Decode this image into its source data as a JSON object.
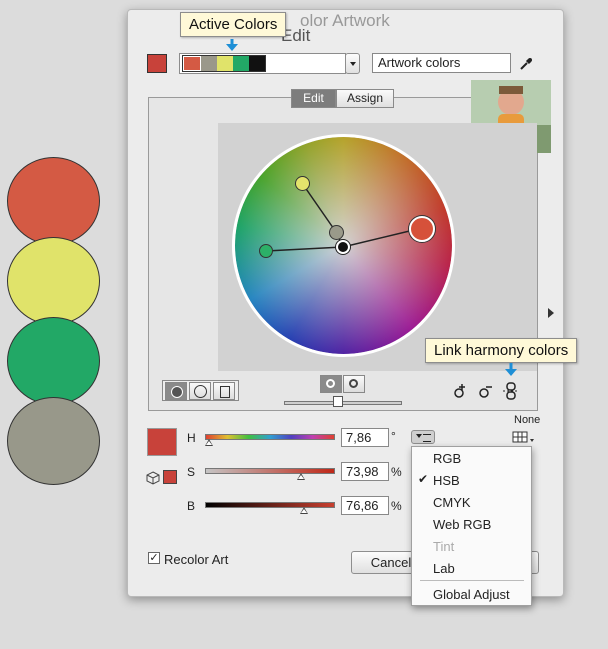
{
  "window": {
    "title": "Recolor Artwork",
    "title_visible": "olor Artwork",
    "subtitle": "Edit"
  },
  "tooltips": {
    "active_colors": "Active Colors",
    "link_harmony": "Link harmony colors"
  },
  "left_swatches": [
    {
      "name": "red",
      "color": "#d45a44"
    },
    {
      "name": "yellow",
      "color": "#e0e36a"
    },
    {
      "name": "green",
      "color": "#22a866"
    },
    {
      "name": "gray",
      "color": "#98988a"
    }
  ],
  "active_colors_strip": [
    "#d45a44",
    "#9a988a",
    "#e0e36a",
    "#22a866",
    "#111111"
  ],
  "group_name": "Artwork colors",
  "tabs": {
    "edit": "Edit",
    "assign": "Assign"
  },
  "wheel_markers": [
    {
      "role": "base",
      "color": "#d6513a"
    },
    {
      "role": "yellow",
      "color": "#e4e36c"
    },
    {
      "role": "green",
      "color": "#2cb068"
    },
    {
      "role": "gray",
      "color": "#9a9a8a"
    }
  ],
  "hsb": {
    "h": {
      "label": "H",
      "value": "7,86",
      "unit": "°"
    },
    "s": {
      "label": "S",
      "value": "73,98",
      "unit": "%"
    },
    "b": {
      "label": "B",
      "value": "76,86",
      "unit": "%"
    }
  },
  "current_color": "#c8423a",
  "none_label": "None",
  "recolor_art": {
    "label": "Recolor Art",
    "checked": true
  },
  "cancel_label": "Cancel",
  "menu": {
    "items": [
      {
        "label": "RGB",
        "checked": false,
        "disabled": false
      },
      {
        "label": "HSB",
        "checked": true,
        "disabled": false
      },
      {
        "label": "CMYK",
        "checked": false,
        "disabled": false
      },
      {
        "label": "Web RGB",
        "checked": false,
        "disabled": false
      },
      {
        "label": "Tint",
        "checked": false,
        "disabled": true
      },
      {
        "label": "Lab",
        "checked": false,
        "disabled": false
      },
      {
        "label": "Global Adjust",
        "checked": false,
        "disabled": false
      }
    ]
  }
}
